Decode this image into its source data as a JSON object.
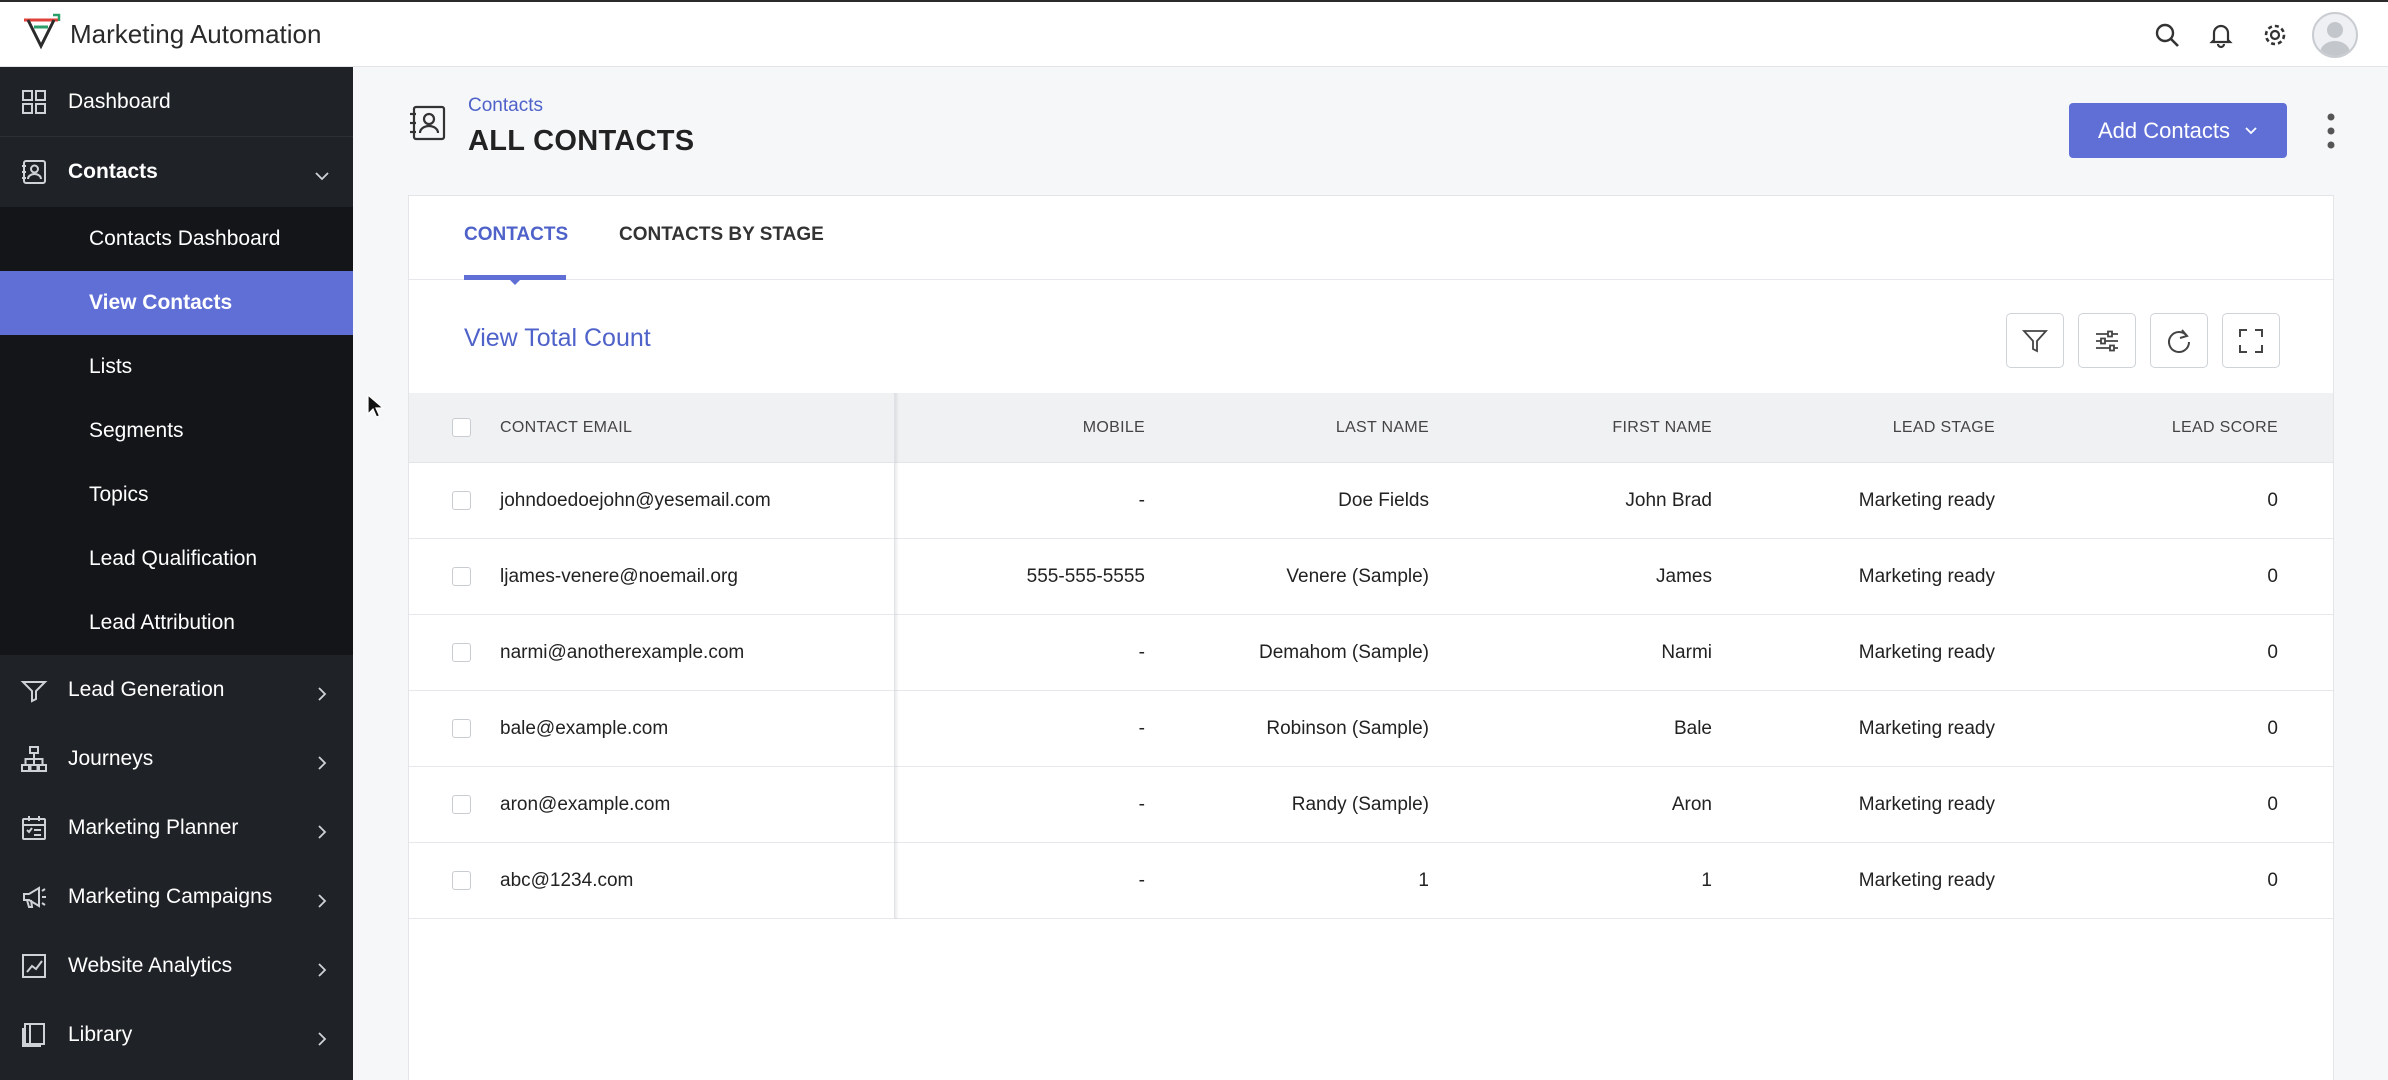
{
  "app": {
    "title": "Marketing Automation"
  },
  "topbar": {
    "icons": [
      "search-icon",
      "bell-icon",
      "gear-icon",
      "avatar"
    ]
  },
  "sidebar": {
    "dashboard": "Dashboard",
    "contacts": {
      "label": "Contacts",
      "items": [
        "Contacts Dashboard",
        "View Contacts",
        "Lists",
        "Segments",
        "Topics",
        "Lead Qualification",
        "Lead Attribution"
      ],
      "active": "View Contacts"
    },
    "groups": [
      "Lead Generation",
      "Journeys",
      "Marketing Planner",
      "Marketing Campaigns",
      "Website Analytics",
      "Library"
    ]
  },
  "page": {
    "breadcrumb": "Contacts",
    "title": "ALL CONTACTS",
    "add_button": "Add Contacts"
  },
  "tabs": [
    "CONTACTS",
    "CONTACTS BY STAGE"
  ],
  "view_total_count": "View Total Count",
  "table": {
    "headers": [
      "CONTACT EMAIL",
      "MOBILE",
      "LAST NAME",
      "FIRST NAME",
      "LEAD STAGE",
      "LEAD SCORE"
    ],
    "rows": [
      [
        "johndoedoejohn@yesemail.com",
        "-",
        "Doe Fields",
        "John Brad",
        "Marketing ready",
        "0"
      ],
      [
        "ljames-venere@noemail.org",
        "555-555-5555",
        "Venere (Sample)",
        "James",
        "Marketing ready",
        "0"
      ],
      [
        "narmi@anotherexample.com",
        "-",
        "Demahom (Sample)",
        "Narmi",
        "Marketing ready",
        "0"
      ],
      [
        "bale@example.com",
        "-",
        "Robinson (Sample)",
        "Bale",
        "Marketing ready",
        "0"
      ],
      [
        "aron@example.com",
        "-",
        "Randy (Sample)",
        "Aron",
        "Marketing ready",
        "0"
      ],
      [
        "abc@1234.com",
        "-",
        "1",
        "1",
        "Marketing ready",
        "0"
      ]
    ]
  },
  "colors": {
    "accent": "#5f6fd6",
    "sidebar": "#1f2226",
    "submenu": "#131518",
    "link": "#4f62c9"
  }
}
